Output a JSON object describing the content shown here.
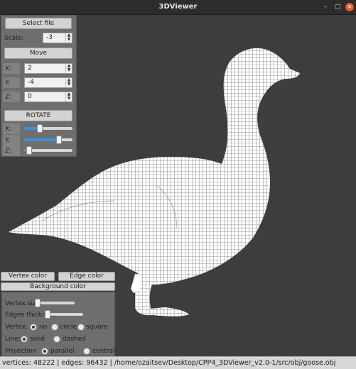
{
  "window": {
    "title": "3DViewer",
    "minimize": "–",
    "maximize": "□",
    "close": "×"
  },
  "controls": {
    "select_file": "Select file",
    "scale": {
      "label": "Scale:",
      "value": "-3"
    },
    "move_button": "Move",
    "move": [
      {
        "label": "X:",
        "value": "2"
      },
      {
        "label": "Y:",
        "value": "-4"
      },
      {
        "label": "Z:",
        "value": "0"
      }
    ],
    "rotate_button": "ROTATE",
    "rotate": [
      {
        "label": "X:",
        "level": 0.3
      },
      {
        "label": "Y:",
        "level": 0.75
      },
      {
        "label": "Z:",
        "level": 0.05
      }
    ]
  },
  "colors": {
    "vertex_color": "Vertex color",
    "edge_color": "Edge color",
    "background_color": "Background color"
  },
  "settings": {
    "vertex_size": {
      "label": "Vertex size:",
      "level": 0.0
    },
    "edges_thickness": {
      "label": "Edges thickness:",
      "level": 0.0
    },
    "vertex": {
      "label": "Vertex:",
      "options": [
        "no",
        "circle",
        "square"
      ],
      "selected": "no"
    },
    "line": {
      "label": "Line:",
      "options": [
        "solid",
        "dashed"
      ],
      "selected": "solid"
    },
    "projection": {
      "label": "Projection",
      "options": [
        "parallel",
        "central"
      ],
      "selected": "parallel"
    }
  },
  "status": "vertices: 48222 | edges: 96432 | /home/ozaitsev/Desktop/CPP4_3DViewer_v2.0-1/src/obj/goose.obj",
  "theme": {
    "viewport_bg": "#3d3d3d",
    "model_color": "#ffffff",
    "slider_accent": "#3d8fd6"
  }
}
